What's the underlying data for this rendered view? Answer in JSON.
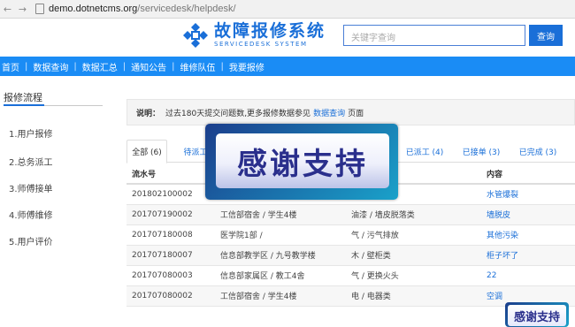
{
  "browser": {
    "url_host": "demo.dotnetcms.org",
    "url_path": "/servicedesk/helpdesk/"
  },
  "header": {
    "logo_cn": "故障报修系统",
    "logo_en": "SERVICEDESK SYSTEM",
    "search_placeholder": "关键字查询",
    "search_button": "查询"
  },
  "nav": {
    "items": [
      "首页",
      "数据查询",
      "数据汇总",
      "通知公告",
      "维修队伍",
      "我要报修"
    ]
  },
  "sidebar": {
    "title": "报修流程",
    "steps": [
      "1.用户报修",
      "2.总务派工",
      "3.师傅接单",
      "4.师傅维修",
      "5.用户评价"
    ]
  },
  "notice": {
    "label": "说明：",
    "text_before": "过去180天提交问题数,更多报修数据参见",
    "link": "数据查询",
    "text_after": "页面"
  },
  "tabs": [
    {
      "label": "全部 (6)",
      "active": true
    },
    {
      "label": "待派工"
    },
    {
      "label": "已派工 (4)"
    },
    {
      "label": "已接单 (3)"
    },
    {
      "label": "已完成 (3)"
    }
  ],
  "table": {
    "headers": [
      "流水号",
      "",
      "",
      "内容"
    ],
    "rows": [
      [
        "201802100002",
        "",
        "",
        "水管爆裂"
      ],
      [
        "201707190002",
        "工信部宿舍 / 学生4楼",
        "油漆 / 墙皮脱落类",
        "墙脱皮"
      ],
      [
        "201707180008",
        "医学院1部 /",
        "气 / 污气排放",
        "其他污染"
      ],
      [
        "201707180007",
        "信息部教学区 / 九号教学楼",
        "木 / 壁柜类",
        "柜子坏了"
      ],
      [
        "201707080003",
        "信息部家属区 / 教工4舍",
        "气 / 更换火头",
        "22"
      ],
      [
        "201707080002",
        "工信部宿舍 / 学生4楼",
        "电 / 电器类",
        "空调"
      ]
    ]
  },
  "overlay": {
    "banner_text": "感谢支持",
    "badge_text": "感谢支持"
  },
  "colors": {
    "brand_blue": "#1a6fd8",
    "nav_blue": "#1a8cf5"
  }
}
